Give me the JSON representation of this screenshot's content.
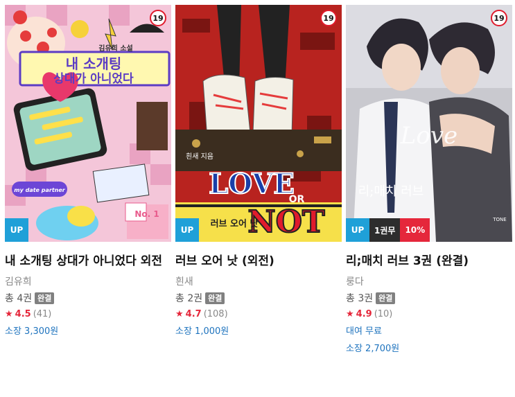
{
  "colors": {
    "badge_up": "#1fa0d8",
    "badge_volume": "#2d2d2d",
    "badge_discount": "#e5273b",
    "rating_red": "#e5273b",
    "price_blue": "#1e73be",
    "done_tag_gray": "#808080"
  },
  "books": [
    {
      "cover_title_line1": "내 소개팅",
      "cover_title_line2": "상대가 아니었다",
      "cover_author_text": "김유희 소설",
      "cover_extra_text": "my date partner",
      "cover_no": "No. 1",
      "age": "19",
      "badge_up": "UP",
      "title": "내 소개팅 상대가 아니었다 외전",
      "author": "김유희",
      "volumes": "총 4권",
      "status": "완결",
      "rating": "4.5",
      "rating_count": "(41)",
      "price": "소장 3,300원"
    },
    {
      "cover_title_line1": "LOVE",
      "cover_title_line2": "OR",
      "cover_title_line3": "NOT",
      "cover_author_text": "흰새 지음",
      "cover_subtitle": "러브 오어 낫",
      "age": "19",
      "badge_up": "UP",
      "title": "러브 오어 낫 (외전)",
      "author": "흰새",
      "volumes": "총 2권",
      "status": "완결",
      "rating": "4.7",
      "rating_count": "(108)",
      "price": "소장 1,000원"
    },
    {
      "cover_title": "리;매치 러브",
      "cover_script": "Love",
      "cover_publisher": "TONE",
      "age": "19",
      "badge_up": "UP",
      "badge_volume": "1권무",
      "badge_discount": "10%",
      "title": "리;매치 러브 3권 (완결)",
      "author": "룽다",
      "volumes": "총 3권",
      "status": "완결",
      "rating": "4.9",
      "rating_count": "(10)",
      "rent": "대여 무료",
      "price": "소장 2,700원"
    }
  ]
}
